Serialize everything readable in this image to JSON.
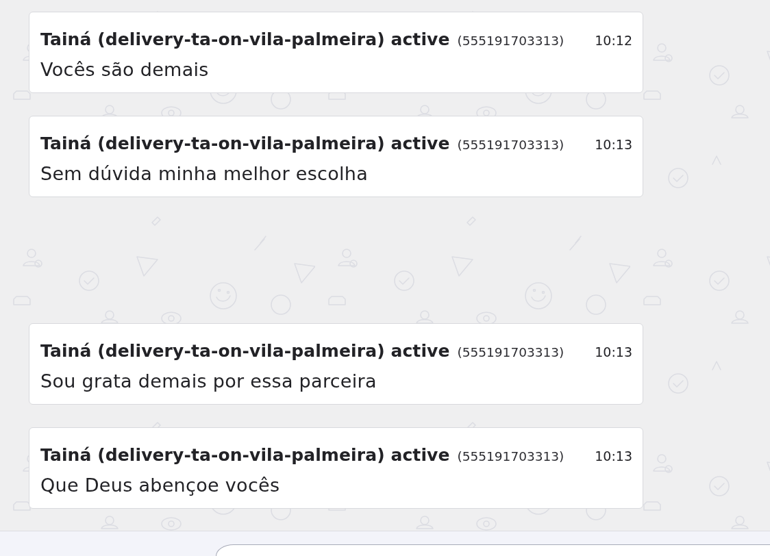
{
  "message_groups": [
    {
      "messages": [
        {
          "sender": "Tainá (delivery-ta-on-vila-palmeira) active",
          "phone": "(555191703313)",
          "time": "10:12",
          "text": "Vocês são demais"
        },
        {
          "sender": "Tainá (delivery-ta-on-vila-palmeira) active",
          "phone": "(555191703313)",
          "time": "10:13",
          "text": "Sem dúvida minha melhor escolha"
        }
      ]
    },
    {
      "messages": [
        {
          "sender": "Tainá (delivery-ta-on-vila-palmeira) active",
          "phone": "(555191703313)",
          "time": "10:13",
          "text": "Sou grata demais por essa parceira"
        },
        {
          "sender": "Tainá (delivery-ta-on-vila-palmeira) active",
          "phone": "(555191703313)",
          "time": "10:13",
          "text": "Que Deus abençoe vocês"
        }
      ]
    }
  ]
}
